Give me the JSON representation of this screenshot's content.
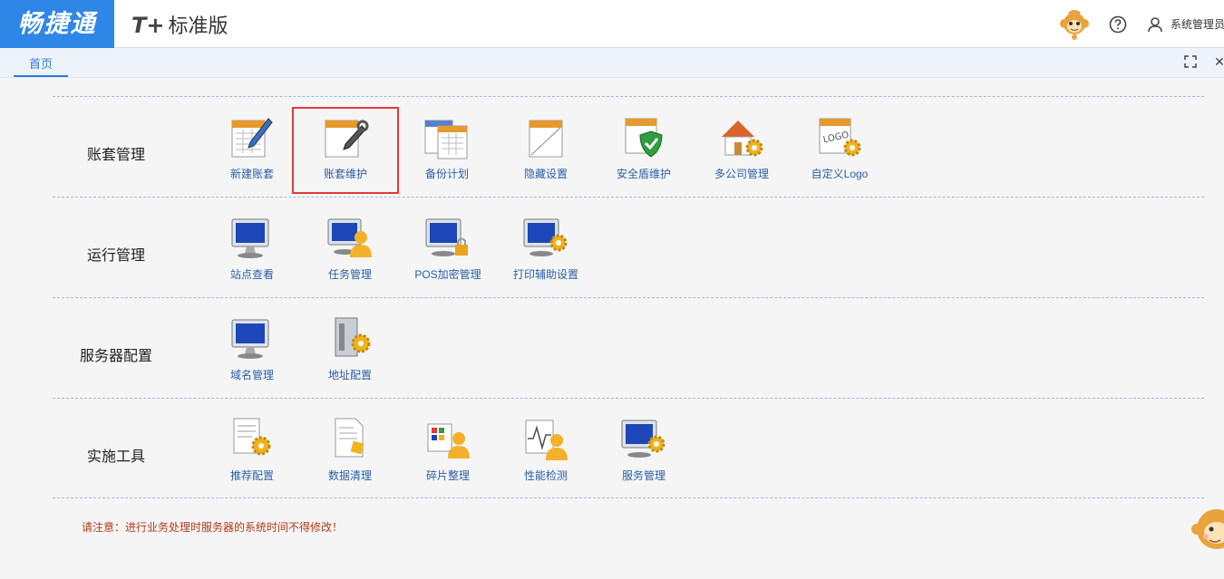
{
  "brand": {
    "name": "畅捷通",
    "color": "#2e86e6"
  },
  "product": {
    "prefix": "T+",
    "edition": "标准版"
  },
  "header": {
    "user_name": "系统管理员",
    "icons": [
      "monkey-mascot-icon",
      "help-icon",
      "user-icon"
    ]
  },
  "tabs": [
    {
      "label": "首页",
      "active": true
    }
  ],
  "tab_controls": {
    "icons": [
      "fullscreen-icon",
      "close-icon"
    ],
    "close_glyph": "✕"
  },
  "sections": [
    {
      "title": "账套管理",
      "items": [
        {
          "label": "新建账套",
          "icon": "new-account-icon"
        },
        {
          "label": "账套维护",
          "icon": "account-maintenance-icon",
          "highlighted": true
        },
        {
          "label": "备份计划",
          "icon": "backup-plan-icon"
        },
        {
          "label": "隐藏设置",
          "icon": "hide-settings-icon"
        },
        {
          "label": "安全盾维护",
          "icon": "security-shield-icon"
        },
        {
          "label": "多公司管理",
          "icon": "multi-company-icon"
        },
        {
          "label": "自定义Logo",
          "icon": "custom-logo-icon"
        }
      ]
    },
    {
      "title": "运行管理",
      "items": [
        {
          "label": "站点查看",
          "icon": "site-view-icon"
        },
        {
          "label": "任务管理",
          "icon": "task-management-icon"
        },
        {
          "label": "POS加密管理",
          "icon": "pos-encryption-icon"
        },
        {
          "label": "打印辅助设置",
          "icon": "print-assist-icon"
        }
      ]
    },
    {
      "title": "服务器配置",
      "items": [
        {
          "label": "域名管理",
          "icon": "domain-management-icon"
        },
        {
          "label": "地址配置",
          "icon": "address-config-icon"
        }
      ]
    },
    {
      "title": "实施工具",
      "items": [
        {
          "label": "推荐配置",
          "icon": "recommended-config-icon"
        },
        {
          "label": "数据清理",
          "icon": "data-cleanup-icon"
        },
        {
          "label": "碎片整理",
          "icon": "defragment-icon"
        },
        {
          "label": "性能检测",
          "icon": "performance-check-icon"
        },
        {
          "label": "服务管理",
          "icon": "service-management-icon"
        }
      ]
    }
  ],
  "notice": "请注意：进行业务处理时服务器的系统时间不得修改！",
  "colors": {
    "accent": "#2e7bd6",
    "highlight": "#e53935",
    "notice": "#b33a1a",
    "label": "#2a5fa8"
  }
}
